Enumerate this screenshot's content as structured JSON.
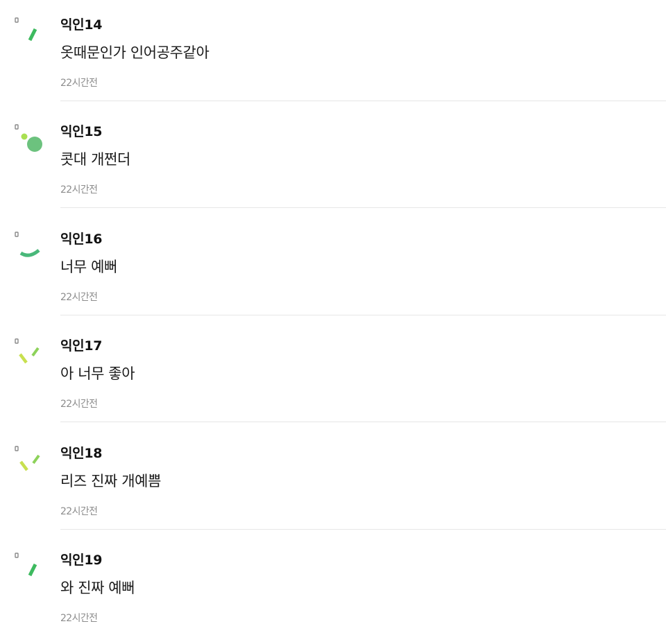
{
  "comments": [
    {
      "author": "익인14",
      "text": "옷때문인가 인어공주같아",
      "time": "22시간전",
      "avatar_icon": "green-slash-avatar-icon"
    },
    {
      "author": "익인15",
      "text": "콧대 개쩐더",
      "time": "22시간전",
      "avatar_icon": "green-dots-avatar-icon"
    },
    {
      "author": "익인16",
      "text": "너무 예뻐",
      "time": "22시간전",
      "avatar_icon": "green-smile-arc-avatar-icon"
    },
    {
      "author": "익인17",
      "text": "아 너무 좋아",
      "time": "22시간전",
      "avatar_icon": "lime-wink-avatar-icon"
    },
    {
      "author": "익인18",
      "text": "리즈 진짜 개예쁨",
      "time": "22시간전",
      "avatar_icon": "lime-wink-avatar-icon"
    },
    {
      "author": "익인19",
      "text": "와 진짜 예뻐",
      "time": "22시간전",
      "avatar_icon": "green-slash-avatar-icon"
    }
  ],
  "colors": {
    "green": "#3dba5f",
    "mint_green": "#6cc27e",
    "lime": "#a9e052",
    "yellow_green": "#c8e04f",
    "text": "#111111",
    "meta": "#8c8c8c",
    "divider": "#e6e6e6"
  }
}
